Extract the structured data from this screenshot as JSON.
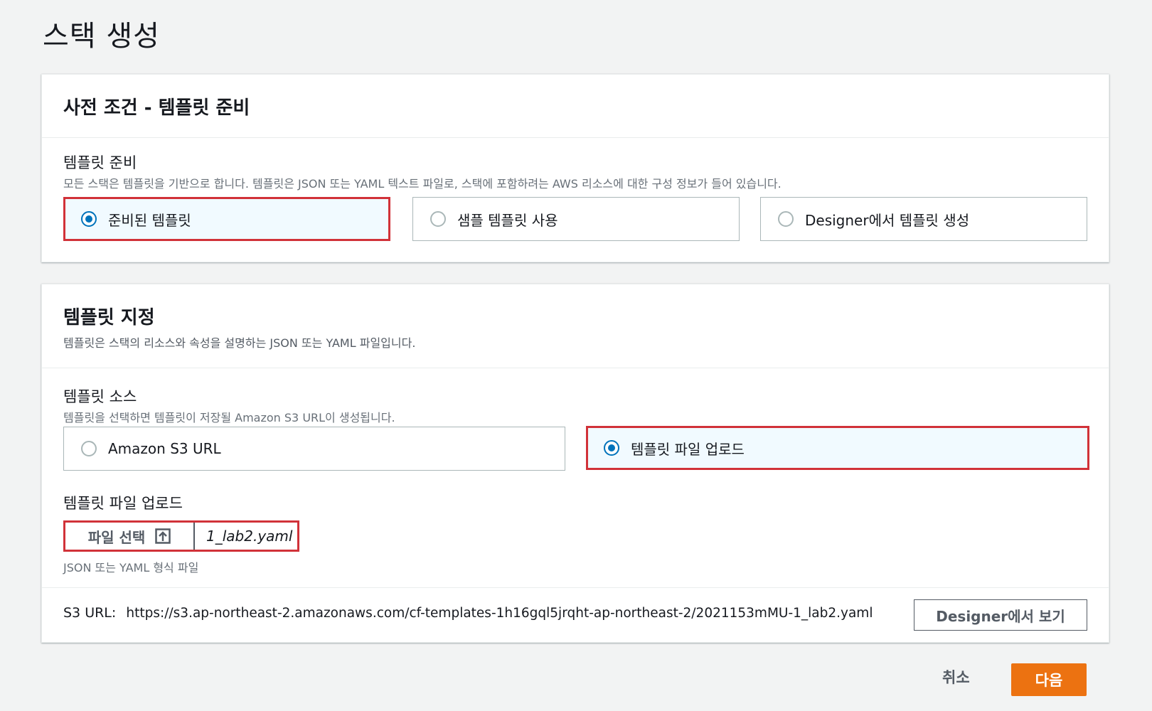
{
  "page": {
    "title": "스택 생성"
  },
  "prerequisite": {
    "title": "사전 조건 - 템플릿 준비",
    "field_label": "템플릿 준비",
    "field_desc": "모든 스택은 템플릿을 기반으로 합니다. 템플릿은 JSON 또는 YAML 텍스트 파일로, 스택에 포함하려는 AWS 리소스에 대한 구성 정보가 들어 있습니다.",
    "options": [
      {
        "label": "준비된 템플릿",
        "selected": true
      },
      {
        "label": "샘플 템플릿 사용",
        "selected": false
      },
      {
        "label": "Designer에서 템플릿 생성",
        "selected": false
      }
    ]
  },
  "specify": {
    "title": "템플릿 지정",
    "subtitle": "템플릿은 스택의 리소스와 속성을 설명하는 JSON 또는 YAML 파일입니다.",
    "source_label": "템플릿 소스",
    "source_desc": "템플릿을 선택하면 템플릿이 저장될 Amazon S3 URL이 생성됩니다.",
    "source_options": [
      {
        "label": "Amazon S3 URL",
        "selected": false
      },
      {
        "label": "템플릿 파일 업로드",
        "selected": true
      }
    ],
    "upload_label": "템플릿 파일 업로드",
    "choose_file_label": "파일 선택",
    "file_name": "1_lab2.yaml",
    "upload_hint": "JSON 또는 YAML 형식 파일",
    "s3_url_label": "S3 URL:",
    "s3_url_value": "https://s3.ap-northeast-2.amazonaws.com/cf-templates-1h16gql5jrqht-ap-northeast-2/2021153mMU-1_lab2.yaml",
    "designer_button": "Designer에서 보기"
  },
  "footer": {
    "cancel_label": "취소",
    "next_label": "다음"
  }
}
